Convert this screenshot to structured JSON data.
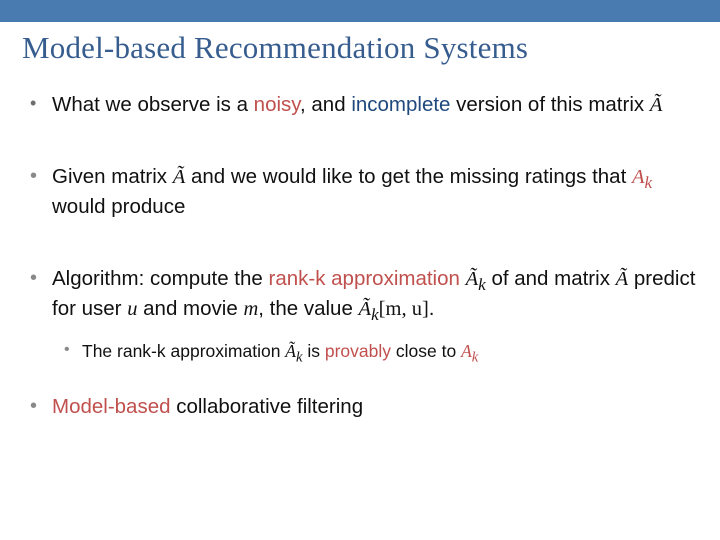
{
  "title": "Model-based Recommendation Systems",
  "b1": {
    "t1": "What we observe is a ",
    "noisy": "noisy",
    "t2": ", and ",
    "incomplete": "incomplete",
    "t3": " version of this matrix ",
    "atilde": "Ã"
  },
  "b2": {
    "t1": "Given matrix ",
    "atilde": "Ã",
    "t2": " and we would like to get the missing ratings that ",
    "ak": "A",
    "aksub": "k",
    "t3": " would produce"
  },
  "b3": {
    "t1": "Algorithm: compute the ",
    "rankk": "rank-k approximation",
    "t2": " ",
    "aktilde": "Ã",
    "aktildesub": "k",
    "t3": " of and matrix ",
    "atilde": "Ã",
    "t4": " predict for user ",
    "u": "u",
    "t5": " and movie ",
    "m": "m",
    "t6": ", the value ",
    "akmu": "Ã",
    "akmusub": "k",
    "akmubr": "[m, u]",
    "t7": "."
  },
  "b3s": {
    "t1": "The rank-k approximation ",
    "aktilde": "Ã",
    "aktildesub": "k",
    "t2": " is ",
    "provably": "provably",
    "t3": " close to ",
    "ak": "A",
    "aksub": "k"
  },
  "b4": {
    "mb": "Model-based ",
    "t1": "collaborative filtering"
  }
}
